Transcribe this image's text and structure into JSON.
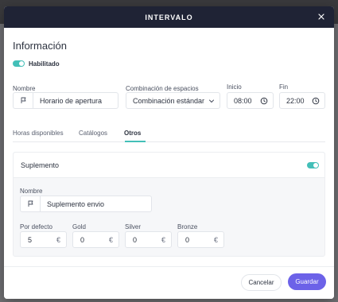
{
  "modal": {
    "title": "INTERVALO"
  },
  "info": {
    "section_title": "Información",
    "enabled_label": "Habilitado",
    "enabled": true,
    "name_label": "Nombre",
    "name_value": "Horario de apertura",
    "combination_label": "Combinación de espacios",
    "combination_value": "Combinación estándar",
    "start_label": "Inicio",
    "start_value": "08:00",
    "end_label": "Fin",
    "end_value": "22:00"
  },
  "tabs": [
    {
      "label": "Horas disponibles",
      "active": false
    },
    {
      "label": "Catálogos",
      "active": false
    },
    {
      "label": "Otros",
      "active": true
    }
  ],
  "supplement": {
    "title": "Suplemento",
    "enabled": true,
    "name_label": "Nombre",
    "name_value": "Suplemento envio",
    "prices": [
      {
        "label": "Por defecto",
        "value": "5",
        "currency": "€"
      },
      {
        "label": "Gold",
        "value": "0",
        "currency": "€"
      },
      {
        "label": "Silver",
        "value": "0",
        "currency": "€"
      },
      {
        "label": "Bronze",
        "value": "0",
        "currency": "€"
      }
    ]
  },
  "footer": {
    "cancel_label": "Cancelar",
    "save_label": "Guardar"
  },
  "icons": {
    "close": "close-icon",
    "flag": "flag-icon",
    "chevron": "chevron-down-icon",
    "clock": "clock-icon"
  },
  "colors": {
    "header_bg": "#1f2335",
    "accent": "#43bfb8",
    "primary_button": "#6c62e8"
  }
}
